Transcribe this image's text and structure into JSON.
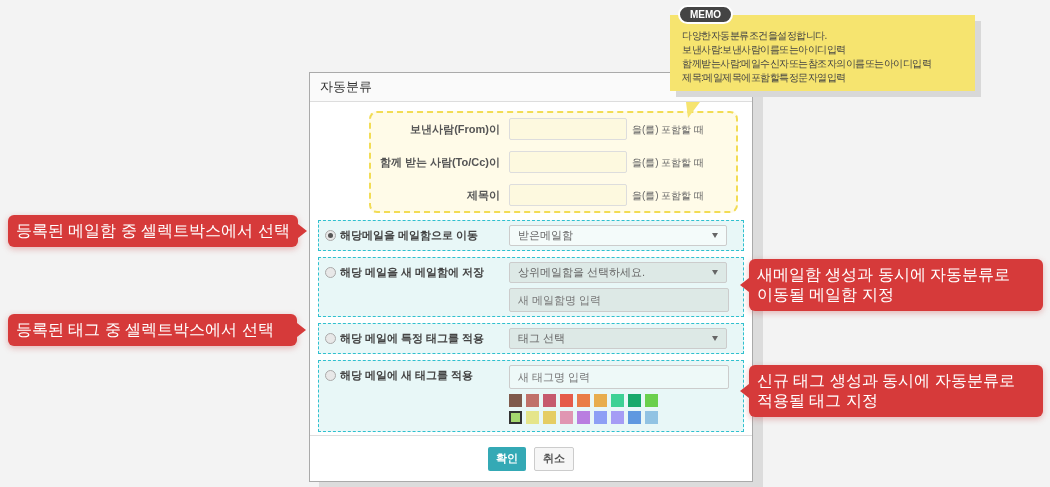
{
  "memo": {
    "badge": "MEMO",
    "lines": [
      "다양한자동분류조건을설정합니다.",
      "보낸사람:보낸사람이름또는아이디입력",
      "함께받는사람:메일수신자또는참조자의이름또는아이디입력",
      "제목:메일제목에포함할특정문자열입력"
    ]
  },
  "dialog": {
    "title": "자동분류",
    "conditions": [
      {
        "label": "보낸사람(From)이",
        "suffix": "을(를) 포함할 때"
      },
      {
        "label": "함께 받는 사람(To/Cc)이",
        "suffix": "을(를) 포함할 때"
      },
      {
        "label": "제목이",
        "suffix": "을(를) 포함할 때"
      }
    ],
    "actions": [
      {
        "label": "해당메일을 메일함으로 이동",
        "selected": true,
        "select": "받은메일함"
      },
      {
        "label": "해당 메일을 새 메일함에 저장",
        "selected": false,
        "select": "상위메일함을 선택하세요.",
        "placeholder": "새 메일함명 입력"
      },
      {
        "label": "해당 메일에 특정 태그를 적용",
        "selected": false,
        "select": "태그 선택"
      },
      {
        "label": "해당 메일에 새 태그를 적용",
        "selected": false,
        "placeholder": "새 태그명 입력",
        "colors": [
          {
            "color": "#7f5a4c",
            "selected": false
          },
          {
            "color": "#c0716a",
            "selected": false
          },
          {
            "color": "#c65a6e",
            "selected": false
          },
          {
            "color": "#e55c4a",
            "selected": false
          },
          {
            "color": "#ea7d46",
            "selected": false
          },
          {
            "color": "#e8ad4e",
            "selected": false
          },
          {
            "color": "#3dd195",
            "selected": false
          },
          {
            "color": "#18a96b",
            "selected": false
          },
          {
            "color": "#6bd04d",
            "selected": false
          },
          {
            "color": "#a5d86f",
            "selected": true
          },
          {
            "color": "#e5e58a",
            "selected": false
          },
          {
            "color": "#e5cd63",
            "selected": false
          },
          {
            "color": "#e096b2",
            "selected": false
          },
          {
            "color": "#b97ee0",
            "selected": false
          },
          {
            "color": "#8d9ff5",
            "selected": false
          },
          {
            "color": "#a59cf5",
            "selected": false
          },
          {
            "color": "#5f98e0",
            "selected": false
          },
          {
            "color": "#91c3e3",
            "selected": false
          }
        ]
      }
    ],
    "buttons": [
      {
        "label": "확인",
        "kind": "primary"
      },
      {
        "label": "취소",
        "kind": "secondary"
      }
    ]
  },
  "callouts": [
    {
      "kind": "left",
      "lines": [
        "등록된 메일함 중 셀렉트박스에서 선택"
      ]
    },
    {
      "kind": "right",
      "lines": [
        "새메일함 생성과 동시에 자동분류로",
        "이동될 메일함 지정"
      ]
    },
    {
      "kind": "left",
      "lines": [
        "등록된 태그 중 셀렉트박스에서 선택"
      ]
    },
    {
      "kind": "right",
      "lines": [
        "신규 태그 생성과 동시에 자동분류로",
        "적용될 태그 지정"
      ]
    }
  ]
}
